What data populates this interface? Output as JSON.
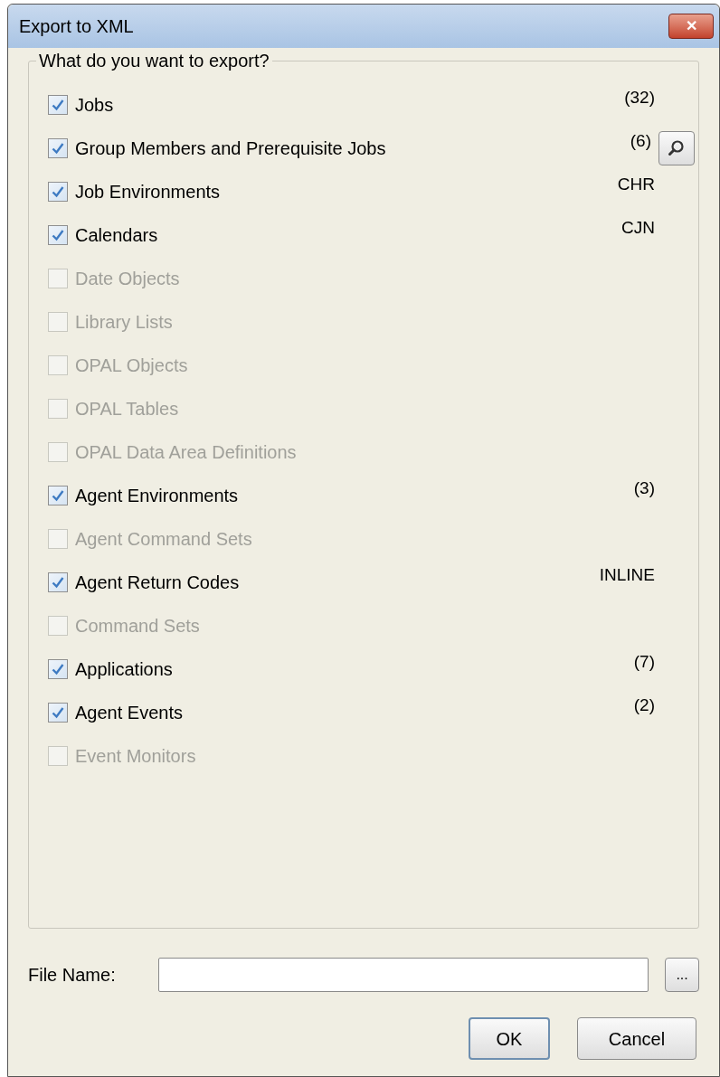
{
  "window": {
    "title": "Export to XML",
    "close_label": "✕"
  },
  "group": {
    "title": "What do you want to export?",
    "items": [
      {
        "label": "Jobs",
        "checked": true,
        "disabled": false,
        "info": "(32)",
        "kind": "plain"
      },
      {
        "label": "Group Members and Prerequisite Jobs",
        "checked": true,
        "disabled": false,
        "info": "(6)",
        "kind": "with-search"
      },
      {
        "label": "Job Environments",
        "checked": true,
        "disabled": false,
        "info": "CHR",
        "kind": "plain"
      },
      {
        "label": "Calendars",
        "checked": true,
        "disabled": false,
        "info": "CJN",
        "kind": "plain"
      },
      {
        "label": "Date Objects",
        "checked": false,
        "disabled": true,
        "kind": "plain"
      },
      {
        "label": "Library Lists",
        "checked": false,
        "disabled": true,
        "kind": "plain"
      },
      {
        "label": "OPAL Objects",
        "checked": false,
        "disabled": true,
        "kind": "plain"
      },
      {
        "label": "OPAL Tables",
        "checked": false,
        "disabled": true,
        "kind": "plain"
      },
      {
        "label": "OPAL Data Area Definitions",
        "checked": false,
        "disabled": true,
        "kind": "plain"
      },
      {
        "label": "Agent Environments",
        "checked": true,
        "disabled": false,
        "info": "(3)",
        "kind": "plain"
      },
      {
        "label": "Agent Command Sets",
        "checked": false,
        "disabled": true,
        "kind": "plain"
      },
      {
        "label": "Agent Return Codes",
        "checked": true,
        "disabled": false,
        "info": "INLINE",
        "kind": "plain"
      },
      {
        "label": "Command Sets",
        "checked": false,
        "disabled": true,
        "kind": "plain"
      },
      {
        "label": "Applications",
        "checked": true,
        "disabled": false,
        "info": "(7)",
        "kind": "plain"
      },
      {
        "label": "Agent Events",
        "checked": true,
        "disabled": false,
        "info": "(2)",
        "kind": "plain"
      },
      {
        "label": "Event Monitors",
        "checked": false,
        "disabled": true,
        "kind": "plain"
      }
    ]
  },
  "file_name": {
    "label": "File Name:",
    "browse_label": "..."
  },
  "buttons": [
    {
      "label": "OK",
      "default": true
    },
    {
      "label": "Cancel",
      "default": false
    }
  ]
}
